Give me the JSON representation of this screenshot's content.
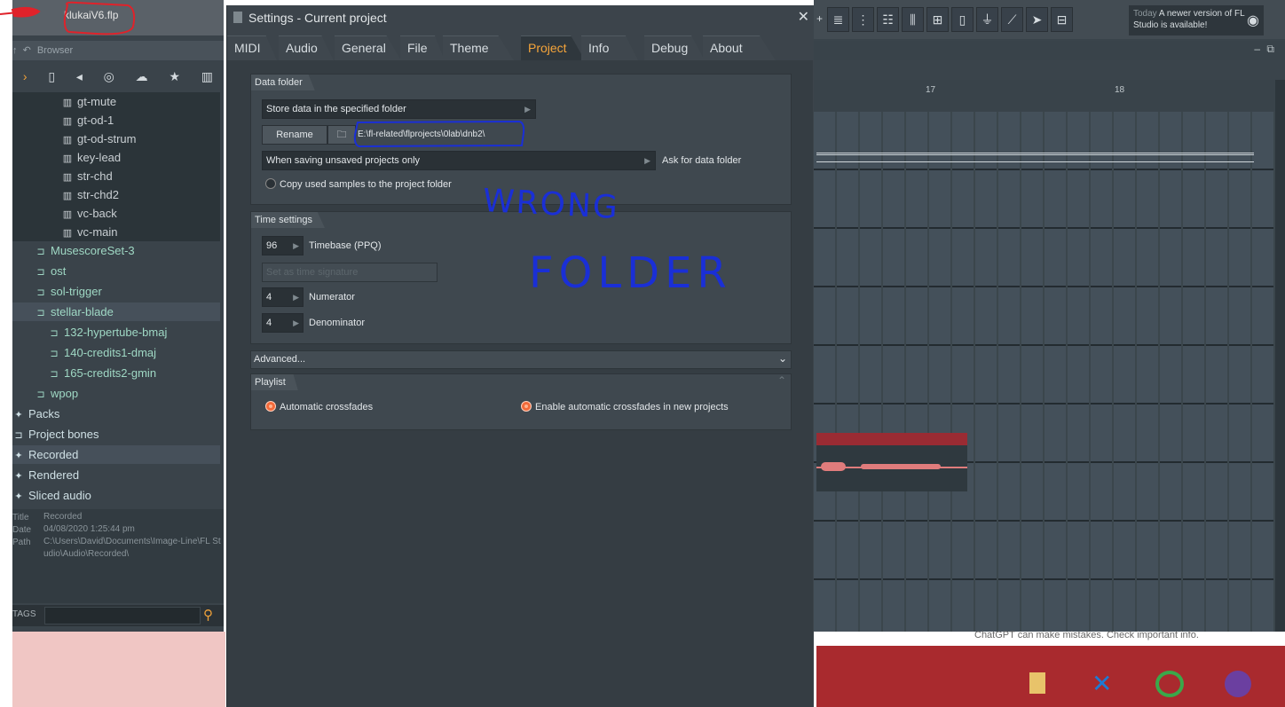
{
  "app": {
    "project_file": "klukaiV6.flp"
  },
  "browser": {
    "header": "Browser",
    "icons": [
      "back-icon",
      "file-icon",
      "speaker-icon",
      "globe-icon",
      "cloud-icon",
      "star-icon",
      "piano-icon"
    ],
    "tree": [
      {
        "label": "gt-mute",
        "kind": "file",
        "indent": 55
      },
      {
        "label": "gt-od-1",
        "kind": "file",
        "indent": 55
      },
      {
        "label": "gt-od-strum",
        "kind": "file",
        "indent": 55
      },
      {
        "label": "key-lead",
        "kind": "file",
        "indent": 55
      },
      {
        "label": "str-chd",
        "kind": "file",
        "indent": 55
      },
      {
        "label": "str-chd2",
        "kind": "file",
        "indent": 55
      },
      {
        "label": "vc-back",
        "kind": "file",
        "indent": 55
      },
      {
        "label": "vc-main",
        "kind": "file",
        "indent": 55
      },
      {
        "label": "MusescoreSet-3",
        "kind": "folder",
        "indent": 25
      },
      {
        "label": "ost",
        "kind": "folder",
        "indent": 25
      },
      {
        "label": "sol-trigger",
        "kind": "folder",
        "indent": 25
      },
      {
        "label": "stellar-blade",
        "kind": "folder-open",
        "indent": 25
      },
      {
        "label": "132-hypertube-bmaj",
        "kind": "folder",
        "indent": 40
      },
      {
        "label": "140-credits1-dmaj",
        "kind": "folder",
        "indent": 40
      },
      {
        "label": "165-credits2-gmin",
        "kind": "folder",
        "indent": 40
      },
      {
        "label": "wpop",
        "kind": "folder",
        "indent": 25
      },
      {
        "label": "Packs",
        "kind": "section",
        "indent": 0
      },
      {
        "label": "Project bones",
        "kind": "section-folder",
        "indent": 0
      },
      {
        "label": "Recorded",
        "kind": "section-hl",
        "indent": 0
      },
      {
        "label": "Rendered",
        "kind": "section",
        "indent": 0
      },
      {
        "label": "Sliced audio",
        "kind": "section",
        "indent": 0
      }
    ],
    "info": {
      "title_key": "Title",
      "title_val": "Recorded",
      "date_key": "Date",
      "date_val": "04/08/2020 1:25:44 pm",
      "path_key": "Path",
      "path_val": "C:\\Users\\David\\Documents\\Image-Line\\FL Studio\\Audio\\Recorded\\"
    },
    "tags_label": "TAGS"
  },
  "dialog": {
    "title": "Settings - Current project",
    "tabs": [
      "MIDI",
      "Audio",
      "General",
      "File",
      "Theme",
      "Project",
      "Info",
      "Debug",
      "About"
    ],
    "active_tab": "Project",
    "data_folder": {
      "header": "Data folder",
      "store_option": "Store data in the specified folder",
      "rename_label": "Rename",
      "path": "E:\\fl-related\\flprojects\\0lab\\dnb2\\",
      "when_option": "When saving unsaved projects only",
      "ask_label": "Ask for data folder",
      "copy_label": "Copy used samples to the project folder"
    },
    "time_settings": {
      "header": "Time settings",
      "timebase_value": "96",
      "timebase_label": "Timebase (PPQ)",
      "set_time_sig": "Set as time signature",
      "numerator_value": "4",
      "numerator_label": "Numerator",
      "denominator_value": "4",
      "denominator_label": "Denominator"
    },
    "advanced_label": "Advanced...",
    "playlist": {
      "header": "Playlist",
      "auto_crossfades": "Automatic crossfades",
      "enable_auto": "Enable automatic crossfades in new projects"
    },
    "annotation": {
      "line1": "WRONG",
      "line2": "FOLDER",
      "color": "#1a2fd6"
    }
  },
  "daw": {
    "news_today": "Today",
    "news_text": "A newer version of FL Studio is available!",
    "bar_17": "17",
    "bar_18": "18"
  },
  "desktop": {
    "chat_notice": "ChatGPT can make mistakes. Check important info."
  }
}
